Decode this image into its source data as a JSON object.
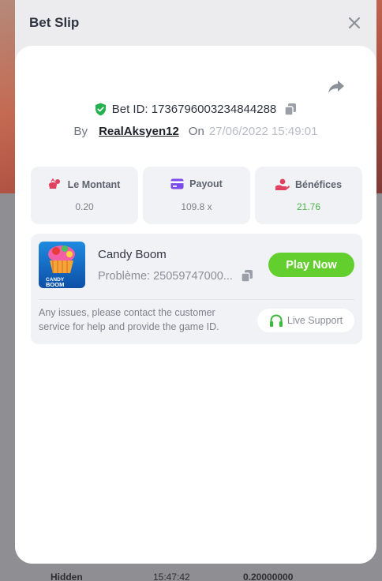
{
  "modal": {
    "title": "Bet Slip",
    "bet_id_label": "Bet ID: 1736796003234844288",
    "by_label": "By",
    "username": "RealAksyen12",
    "on_label": "On",
    "date": "27/06/2022 15:49:01"
  },
  "stats": [
    {
      "label": "Le Montant",
      "value": "0.20",
      "icon": "bag-icon"
    },
    {
      "label": "Payout",
      "value": "109.8 x",
      "icon": "card-icon"
    },
    {
      "label": "Bénéfices",
      "value": "21.76",
      "icon": "hand-coin-icon"
    }
  ],
  "game": {
    "name": "Candy Boom",
    "problem": "Problème: 25059747000...",
    "play_label": "Play Now",
    "thumb_text_top": "CANDY",
    "thumb_text_bottom": "BOOM",
    "issues_text": "Any issues, please contact the customer service for help and provide the game ID.",
    "support_label": "Live Support"
  },
  "background": {
    "bottom_row_user": "Hidden",
    "bottom_row_time": "15:47:42",
    "bottom_row_amount": "0.20000000"
  },
  "colors": {
    "accent_green": "#63cf2e",
    "profit_green": "#4cb34a",
    "shield_green": "#22b14c"
  }
}
